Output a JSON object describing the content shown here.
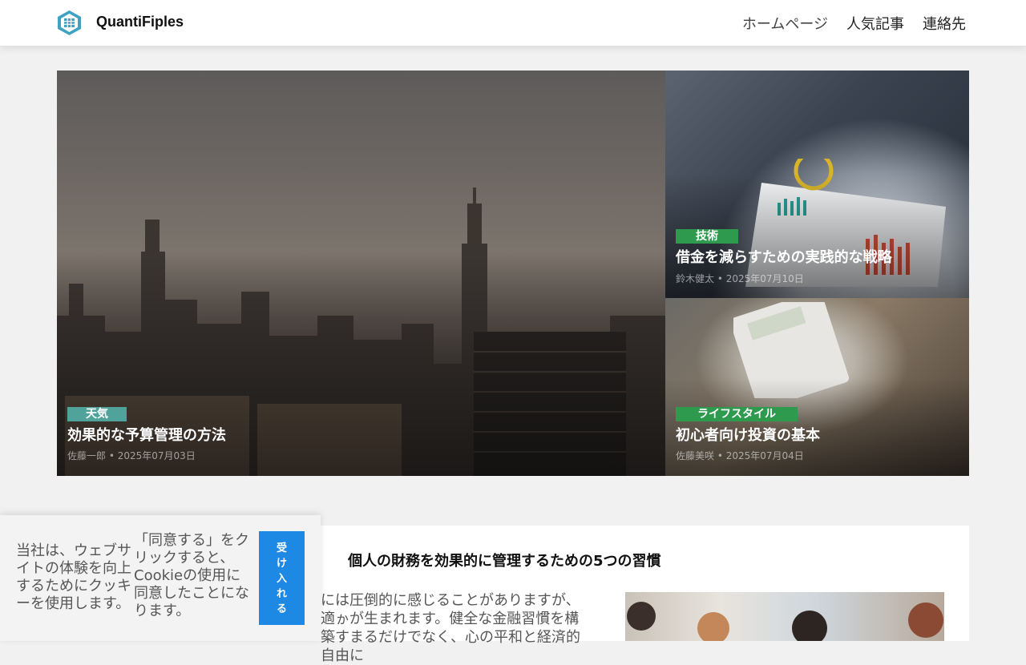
{
  "header": {
    "brand": "QuantiFiples",
    "nav": [
      "ホームページ",
      "人気記事",
      "連絡先"
    ]
  },
  "hero": {
    "main": {
      "category": "天気",
      "category_color": "#4fa39a",
      "title": "効果的な予算管理の方法",
      "meta": "佐藤一郎 • 2025年07月03日"
    },
    "side_top": {
      "category": "技術",
      "category_color": "#2e9a4e",
      "title": "借金を減らすための実践的な戦略",
      "meta": "鈴木健太 • 2025年07月10日"
    },
    "side_bottom": {
      "category": "ライフスタイル",
      "category_color": "#2e9a4e",
      "title": "初心者向け投資の基本",
      "meta": "佐藤美咲 • 2025年07月04日"
    }
  },
  "article": {
    "title": "個人の財務を効果的に管理するための5つの習慣",
    "excerpt": "には圧倒的に感じることがありますが、適ゕが生まれます。健全な金融習慣を構築すまるだけでなく、心の平和と経済的自由に"
  },
  "cookie": {
    "text_left": "当社は、ウェブサイトの体験を向上するためにクッキーを使用します。",
    "text_right": "「同意する」をクリックすると、Cookieの使用に同意したことになります。",
    "accept": "受け入れる"
  }
}
